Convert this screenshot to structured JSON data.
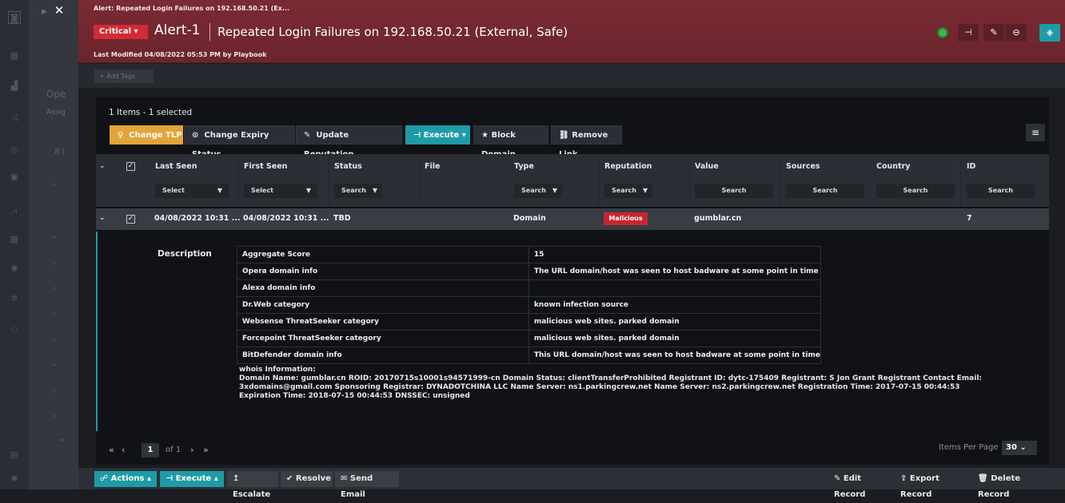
{
  "header": {
    "breadcrumb": "Alert: Repeated Login Failures on 192.168.50.21 (Ex...",
    "severity": "Critical",
    "alert_id": "Alert-1",
    "title": "Repeated Login Failures on 192.168.50.21 (External, Safe)",
    "last_modified": "Last Modified 04/08/2022 05:53 PM by Playbook"
  },
  "tags": {
    "add_label": "+ Add Tags"
  },
  "behind_panel": {
    "tab_fragment": "Ope",
    "assign_fragment": "Assig",
    "count_fragment": "8 I"
  },
  "grid": {
    "items_count": "1 Items - 1 selected",
    "toolbar": {
      "change_tlp": "Change TLP",
      "change_expiry": "Change Expiry Status",
      "update_reputation": "Update Reputation",
      "execute": "Execute",
      "block_domain": "Block Domain",
      "remove_link": "Remove Link"
    },
    "columns": [
      "Last Seen",
      "First Seen",
      "Status",
      "File",
      "Type",
      "Reputation",
      "Value",
      "Sources",
      "Country",
      "ID"
    ],
    "filters": {
      "last_seen": "Select",
      "first_seen": "Select",
      "status": "Search",
      "type": "Search",
      "reputation": "Search",
      "value": "Search",
      "sources": "Search",
      "country": "Search",
      "id": "Search"
    },
    "row": {
      "last_seen": "04/08/2022 10:31 ...",
      "first_seen": "04/08/2022 10:31 ...",
      "status": "TBD",
      "file": "",
      "type": "Domain",
      "reputation": "Malicious",
      "value": "gumblar.cn",
      "sources": "",
      "country": "",
      "id": "7"
    }
  },
  "detail": {
    "label": "Description",
    "rows": [
      {
        "key": "Aggregate Score",
        "value": "15"
      },
      {
        "key": "Opera domain info",
        "value": "The URL domain/host was seen to host badware at some point in time"
      },
      {
        "key": "Alexa domain info",
        "value": ""
      },
      {
        "key": "Dr.Web category",
        "value": "known infection source"
      },
      {
        "key": "Websense ThreatSeeker category",
        "value": "malicious web sites. parked domain"
      },
      {
        "key": "Forcepoint ThreatSeeker category",
        "value": "malicious web sites. parked domain"
      },
      {
        "key": "BitDefender domain info",
        "value": "This URL domain/host was seen to host badware at some point in time"
      }
    ],
    "whois_title": "whois Information:",
    "whois_text": "Domain Name: gumblar.cn ROID: 20170715s10001s94571999-cn Domain Status: clientTransferProhibited Registrant ID: dytc-175409 Registrant: S Jon Grant Registrant Contact Email: 3xdomains@gmail.com Sponsoring Registrar: DYNADOTCHINA LLC Name Server: ns1.parkingcrew.net Name Server: ns2.parkingcrew.net Registration Time: 2017-07-15 00:44:53 Expiration Time: 2018-07-15 00:44:53 DNSSEC: unsigned"
  },
  "pagination": {
    "current_page": "1",
    "of_label": "of 1",
    "items_per_page_label": "Items Per Page",
    "items_per_page": "30"
  },
  "footer": {
    "actions": "Actions",
    "execute": "Execute",
    "escalate": "Escalate",
    "resolve": "Resolve",
    "send_email": "Send Email",
    "edit_record": "Edit Record",
    "export_record": "Export Record",
    "delete_record": "Delete Record"
  },
  "colors": {
    "header_bg": "#7a2a33",
    "critical": "#d42a35",
    "tlp": "#e3a43a",
    "teal": "#1e9ba6",
    "malicious": "#c62632"
  }
}
